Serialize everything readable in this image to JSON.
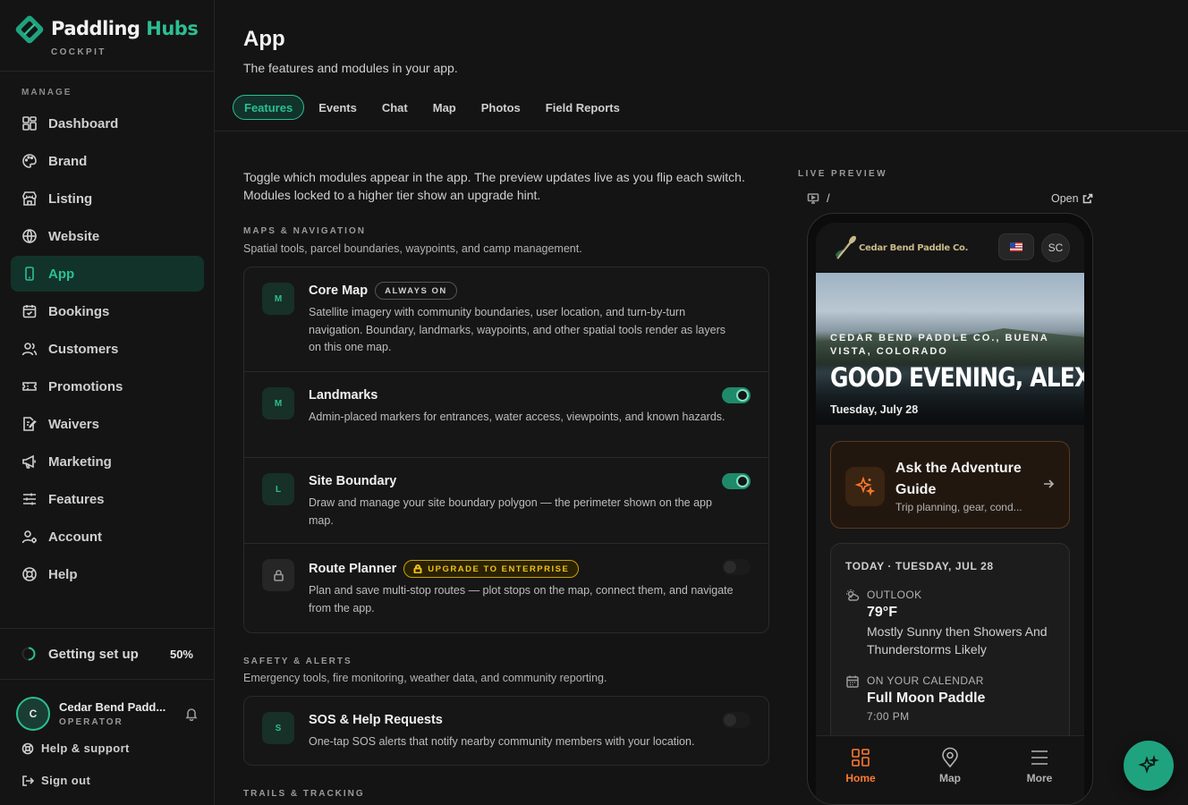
{
  "brand": {
    "name_part1": "Paddling",
    "name_part2": "Hubs",
    "subtitle": "COCKPIT",
    "accent": "#2bbf92"
  },
  "sidebar": {
    "section_label": "MANAGE",
    "items": [
      {
        "label": "Dashboard",
        "icon": "dashboard-icon"
      },
      {
        "label": "Brand",
        "icon": "palette-icon"
      },
      {
        "label": "Listing",
        "icon": "store-icon"
      },
      {
        "label": "Website",
        "icon": "globe-icon"
      },
      {
        "label": "App",
        "icon": "phone-icon",
        "active": true
      },
      {
        "label": "Bookings",
        "icon": "calendar-icon"
      },
      {
        "label": "Customers",
        "icon": "users-icon"
      },
      {
        "label": "Promotions",
        "icon": "ticket-icon"
      },
      {
        "label": "Waivers",
        "icon": "waiver-icon"
      },
      {
        "label": "Marketing",
        "icon": "megaphone-icon"
      },
      {
        "label": "Features",
        "icon": "sliders-icon"
      },
      {
        "label": "Account",
        "icon": "account-icon"
      },
      {
        "label": "Help",
        "icon": "lifebuoy-icon"
      }
    ],
    "setup": {
      "label": "Getting set up",
      "percent": "50%",
      "progress": 0.5
    },
    "user": {
      "initial": "C",
      "name": "Cedar Bend Padd...",
      "role": "OPERATOR"
    },
    "help_link": "Help & support",
    "signout_link": "Sign out"
  },
  "header": {
    "title": "App",
    "subtitle": "The features and modules in your app.",
    "tabs": [
      "Features",
      "Events",
      "Chat",
      "Map",
      "Photos",
      "Field Reports"
    ],
    "active_tab": "Features"
  },
  "intro": "Toggle which modules appear in the app. The preview updates live as you flip each switch. Modules locked to a higher tier show an upgrade hint.",
  "groups": [
    {
      "label": "MAPS & NAVIGATION",
      "description": "Spatial tools, parcel boundaries, waypoints, and camp management.",
      "modules": [
        {
          "tile": "M",
          "title": "Core Map",
          "badge": "ALWAYS ON",
          "description": "Satellite imagery with community boundaries, user location, and turn-by-turn navigation. Boundary, landmarks, waypoints, and other spatial tools render as layers on this one map."
        },
        {
          "tile": "M",
          "title": "Landmarks",
          "enabled": true,
          "description": "Admin-placed markers for entrances, water access, viewpoints, and known hazards."
        },
        {
          "tile": "L",
          "title": "Site Boundary",
          "enabled": true,
          "description": "Draw and manage your site boundary polygon — the perimeter shown on the app map."
        },
        {
          "tile": "lock-icon",
          "title": "Route Planner",
          "badge": "UPGRADE TO ENTERPRISE",
          "enabled": false,
          "description": "Plan and save multi-stop routes — plot stops on the map, connect them, and navigate from the app."
        }
      ]
    },
    {
      "label": "SAFETY & ALERTS",
      "description": "Emergency tools, fire monitoring, weather data, and community reporting.",
      "modules": [
        {
          "tile": "S",
          "title": "SOS & Help Requests",
          "enabled": false,
          "description": "One-tap SOS alerts that notify nearby community members with your location."
        }
      ]
    },
    {
      "label": "TRAILS & TRACKING"
    }
  ],
  "preview": {
    "label": "LIVE PREVIEW",
    "route": "/",
    "open_label": "Open",
    "app": {
      "org_name": "Cedar Bend Paddle Co.",
      "user_initials": "SC",
      "hero_location": "CEDAR BEND PADDLE CO., BUENA VISTA, COLORADO",
      "hero_greeting": "GOOD EVENING, ALEX",
      "hero_date": "Tuesday, July 28",
      "guide_title": "Ask the Adventure Guide",
      "guide_sub": "Trip planning, gear, cond...",
      "today_header": "TODAY · TUESDAY, JUL 28",
      "outlook_label": "OUTLOOK",
      "outlook_temp": "79°F",
      "outlook_desc": "Mostly Sunny then Showers And Thunderstorms Likely",
      "calendar_label": "ON YOUR CALENDAR",
      "calendar_event": "Full Moon Paddle",
      "calendar_time": "7:00 PM",
      "tabs": [
        "Home",
        "Map",
        "More"
      ],
      "accent": "#ff7a30"
    }
  }
}
